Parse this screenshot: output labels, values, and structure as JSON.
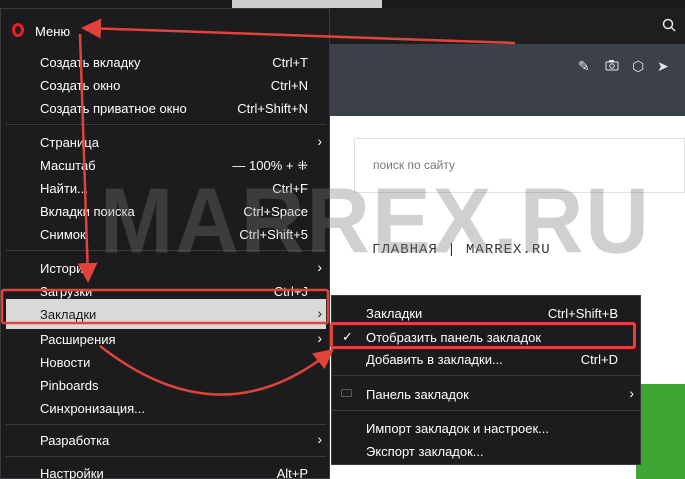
{
  "menu": {
    "title": "Меню",
    "items": [
      {
        "label": "Создать вкладку",
        "shortcut": "Ctrl+T"
      },
      {
        "label": "Создать окно",
        "shortcut": "Ctrl+N"
      },
      {
        "label": "Создать приватное окно",
        "shortcut": "Ctrl+Shift+N"
      },
      {
        "label": "Страница",
        "shortcut": ""
      },
      {
        "label": "Масштаб",
        "shortcut": "— 100% +  ⁜"
      },
      {
        "label": "Найти...",
        "shortcut": "Ctrl+F"
      },
      {
        "label": "Вкладки поиска",
        "shortcut": "Ctrl+Space"
      },
      {
        "label": "Снимок",
        "shortcut": "Ctrl+Shift+5"
      },
      {
        "label": "История",
        "shortcut": ""
      },
      {
        "label": "Загрузки",
        "shortcut": "Ctrl+J"
      },
      {
        "label": "Закладки",
        "shortcut": ""
      },
      {
        "label": "Расширения",
        "shortcut": ""
      },
      {
        "label": "Новости",
        "shortcut": ""
      },
      {
        "label": "Pinboards",
        "shortcut": ""
      },
      {
        "label": "Синхронизация...",
        "shortcut": ""
      },
      {
        "label": "Разработка",
        "shortcut": ""
      },
      {
        "label": "Настройки",
        "shortcut": "Alt+P"
      }
    ]
  },
  "submenu": {
    "items": [
      {
        "label": "Закладки",
        "shortcut": "Ctrl+Shift+B"
      },
      {
        "label": "Отобразить панель закладок",
        "shortcut": ""
      },
      {
        "label": "Добавить в закладки...",
        "shortcut": "Ctrl+D"
      },
      {
        "label": "Панель закладок",
        "shortcut": ""
      },
      {
        "label": "Импорт закладок и настроек...",
        "shortcut": ""
      },
      {
        "label": "Экспорт закладок...",
        "shortcut": ""
      }
    ]
  },
  "page": {
    "search_placeholder": "поиск по сайту",
    "site_title": "ГЛАВНАЯ | MARREX.RU"
  },
  "watermark": "MARREX.RU",
  "colors": {
    "accent": "#e0433a",
    "highlight": "#d9d9d9",
    "menu_bg": "#1c1c1e"
  }
}
